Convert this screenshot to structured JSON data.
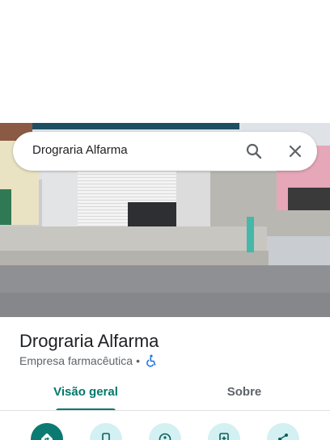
{
  "search": {
    "query": "Drograria Alfarma"
  },
  "place": {
    "name": "Drograria Alfarma",
    "category": "Empresa farmacêutica",
    "separator": "•"
  },
  "tabs": [
    {
      "label": "Visão geral",
      "active": true
    },
    {
      "label": "Sobre",
      "active": false
    }
  ],
  "icons": {
    "search": "search-icon",
    "close": "close-icon",
    "accessibility": "wheelchair-icon",
    "actions": [
      "directions-icon",
      "phone-icon",
      "street-view-icon",
      "save-icon",
      "share-icon"
    ]
  },
  "colors": {
    "accent": "#00796b",
    "primary_action": "#0b7a72",
    "secondary_action": "#d3f0f2",
    "accessibility_icon": "#1a73e8"
  }
}
